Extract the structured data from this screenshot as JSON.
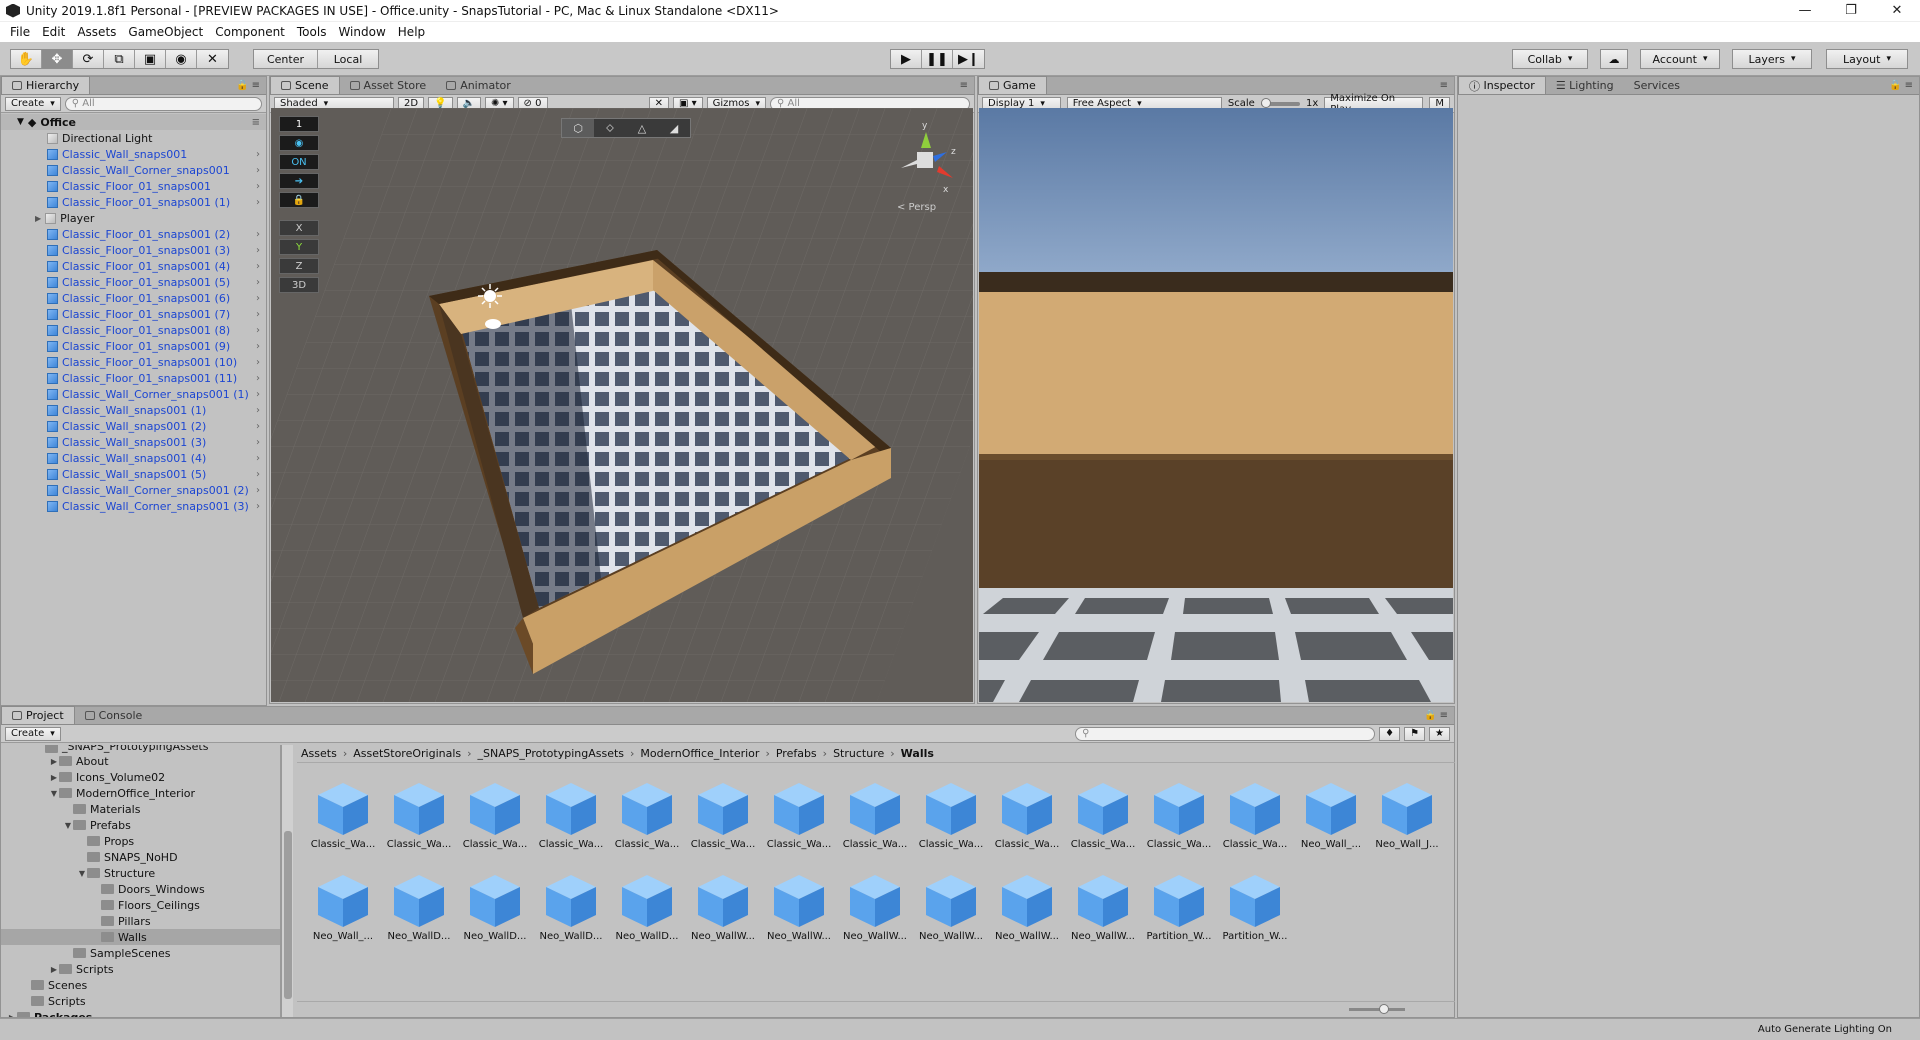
{
  "window": {
    "title": "Unity 2019.1.8f1 Personal - [PREVIEW PACKAGES IN USE] - Office.unity - SnapsTutorial - PC, Mac & Linux Standalone <DX11>"
  },
  "menu": [
    "File",
    "Edit",
    "Assets",
    "GameObject",
    "Component",
    "Tools",
    "Window",
    "Help"
  ],
  "toolbar": {
    "pivot": "Center",
    "space": "Local",
    "collab": "Collab",
    "account": "Account",
    "layers": "Layers",
    "layout": "Layout"
  },
  "hierarchy": {
    "tab": "Hierarchy",
    "create": "Create",
    "search_placeholder": "All",
    "scene": "Office",
    "items": [
      {
        "label": "Directional Light",
        "blue": false,
        "indent": 1
      },
      {
        "label": "Classic_Wall_snaps001",
        "blue": true,
        "indent": 1
      },
      {
        "label": "Classic_Wall_Corner_snaps001",
        "blue": true,
        "indent": 1
      },
      {
        "label": "Classic_Floor_01_snaps001",
        "blue": true,
        "indent": 1
      },
      {
        "label": "Classic_Floor_01_snaps001 (1)",
        "blue": true,
        "indent": 1
      },
      {
        "label": "Player",
        "blue": false,
        "indent": 1,
        "expand": true
      },
      {
        "label": "Classic_Floor_01_snaps001 (2)",
        "blue": true,
        "indent": 1
      },
      {
        "label": "Classic_Floor_01_snaps001 (3)",
        "blue": true,
        "indent": 1
      },
      {
        "label": "Classic_Floor_01_snaps001 (4)",
        "blue": true,
        "indent": 1
      },
      {
        "label": "Classic_Floor_01_snaps001 (5)",
        "blue": true,
        "indent": 1
      },
      {
        "label": "Classic_Floor_01_snaps001 (6)",
        "blue": true,
        "indent": 1
      },
      {
        "label": "Classic_Floor_01_snaps001 (7)",
        "blue": true,
        "indent": 1
      },
      {
        "label": "Classic_Floor_01_snaps001 (8)",
        "blue": true,
        "indent": 1
      },
      {
        "label": "Classic_Floor_01_snaps001 (9)",
        "blue": true,
        "indent": 1
      },
      {
        "label": "Classic_Floor_01_snaps001 (10)",
        "blue": true,
        "indent": 1
      },
      {
        "label": "Classic_Floor_01_snaps001 (11)",
        "blue": true,
        "indent": 1
      },
      {
        "label": "Classic_Wall_Corner_snaps001 (1)",
        "blue": true,
        "indent": 1
      },
      {
        "label": "Classic_Wall_snaps001 (1)",
        "blue": true,
        "indent": 1
      },
      {
        "label": "Classic_Wall_snaps001 (2)",
        "blue": true,
        "indent": 1
      },
      {
        "label": "Classic_Wall_snaps001 (3)",
        "blue": true,
        "indent": 1
      },
      {
        "label": "Classic_Wall_snaps001 (4)",
        "blue": true,
        "indent": 1
      },
      {
        "label": "Classic_Wall_snaps001 (5)",
        "blue": true,
        "indent": 1
      },
      {
        "label": "Classic_Wall_Corner_snaps001 (2)",
        "blue": true,
        "indent": 1
      },
      {
        "label": "Classic_Wall_Corner_snaps001 (3)",
        "blue": true,
        "indent": 1
      }
    ]
  },
  "scene": {
    "tabs": [
      "Scene",
      "Asset Store",
      "Animator"
    ],
    "shading": "Shaded",
    "mode2d": "2D",
    "fx_count": "0",
    "gizmos": "Gizmos",
    "search_placeholder": "All",
    "persp": "< Persp",
    "snap_buttons": [
      "1",
      "",
      "ON",
      "",
      "",
      "X",
      "Y",
      "Z",
      "3D"
    ]
  },
  "game": {
    "tab": "Game",
    "display": "Display 1",
    "aspect": "Free Aspect",
    "scale_label": "Scale",
    "scale_value": "1x",
    "maximize": "Maximize On Play",
    "mute": "M"
  },
  "inspector": {
    "tabs": [
      "Inspector",
      "Lighting",
      "Services"
    ]
  },
  "project": {
    "tabs": [
      "Project",
      "Console"
    ],
    "create": "Create",
    "tree": [
      {
        "label": "_SNAPS_PrototypingAssets",
        "indent": 2,
        "tri": "",
        "cut": true
      },
      {
        "label": "About",
        "indent": 3,
        "tri": "▶"
      },
      {
        "label": "Icons_Volume02",
        "indent": 3,
        "tri": "▶"
      },
      {
        "label": "ModernOffice_Interior",
        "indent": 3,
        "tri": "▼"
      },
      {
        "label": "Materials",
        "indent": 4,
        "tri": ""
      },
      {
        "label": "Prefabs",
        "indent": 4,
        "tri": "▼"
      },
      {
        "label": "Props",
        "indent": 5,
        "tri": ""
      },
      {
        "label": "SNAPS_NoHD",
        "indent": 5,
        "tri": ""
      },
      {
        "label": "Structure",
        "indent": 5,
        "tri": "▼"
      },
      {
        "label": "Doors_Windows",
        "indent": 6,
        "tri": ""
      },
      {
        "label": "Floors_Ceilings",
        "indent": 6,
        "tri": ""
      },
      {
        "label": "Pillars",
        "indent": 6,
        "tri": ""
      },
      {
        "label": "Walls",
        "indent": 6,
        "tri": "",
        "selected": true
      },
      {
        "label": "SampleScenes",
        "indent": 4,
        "tri": ""
      },
      {
        "label": "Scripts",
        "indent": 3,
        "tri": "▶"
      },
      {
        "label": "Scenes",
        "indent": 1,
        "tri": ""
      },
      {
        "label": "Scripts",
        "indent": 1,
        "tri": ""
      },
      {
        "label": "Packages",
        "indent": 0,
        "tri": "▶",
        "bold": true
      }
    ],
    "breadcrumb": [
      "Assets",
      "AssetStoreOriginals",
      "_SNAPS_PrototypingAssets",
      "ModernOffice_Interior",
      "Prefabs",
      "Structure",
      "Walls"
    ],
    "assets_row1": [
      "Classic_Wa...",
      "Classic_Wa...",
      "Classic_Wa...",
      "Classic_Wa...",
      "Classic_Wa...",
      "Classic_Wa...",
      "Classic_Wa...",
      "Classic_Wa...",
      "Classic_Wa...",
      "Classic_Wa...",
      "Classic_Wa...",
      "Classic_Wa...",
      "Classic_Wa...",
      "Neo_Wall_...",
      "Neo_Wall_J..."
    ],
    "assets_row2": [
      "Neo_Wall_...",
      "Neo_WallD...",
      "Neo_WallD...",
      "Neo_WallD...",
      "Neo_WallD...",
      "Neo_WallW...",
      "Neo_WallW...",
      "Neo_WallW...",
      "Neo_WallW...",
      "Neo_WallW...",
      "Neo_WallW...",
      "Partition_W...",
      "Partition_W..."
    ]
  },
  "status": {
    "lighting": "Auto Generate Lighting On"
  }
}
